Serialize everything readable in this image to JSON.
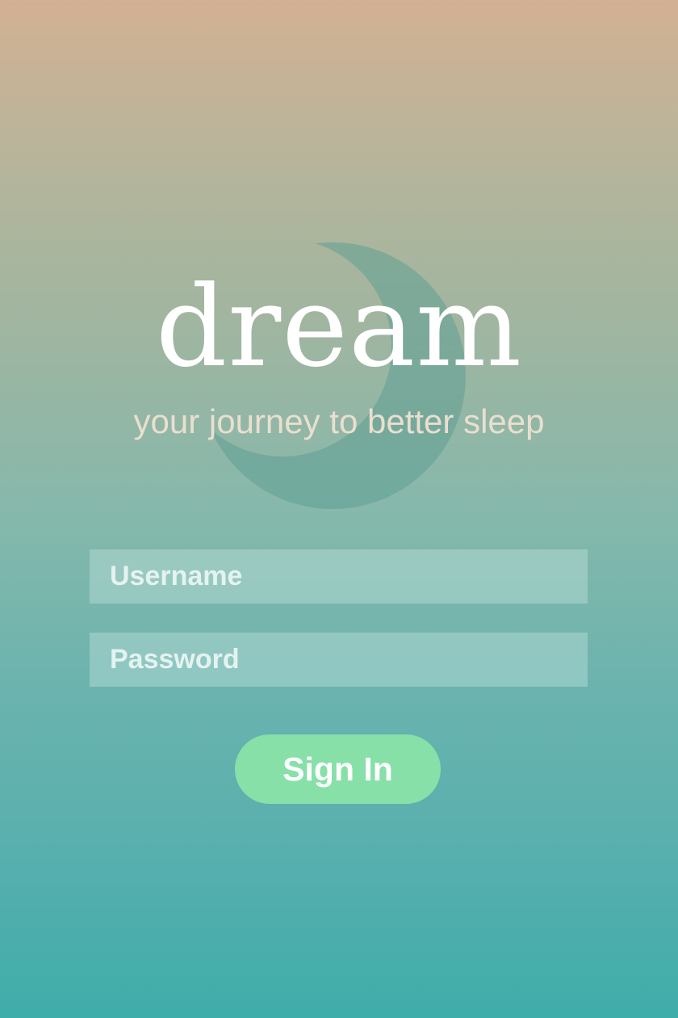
{
  "app": {
    "brand": "dream",
    "tagline": "your journey to better sleep"
  },
  "login": {
    "username_placeholder": "Username",
    "password_placeholder": "Password",
    "sign_in_label": "Sign In"
  },
  "decor": {
    "moon_icon": "crescent-moon-icon",
    "moon_color": "#5f9f94",
    "button_color": "#86e0a8"
  }
}
